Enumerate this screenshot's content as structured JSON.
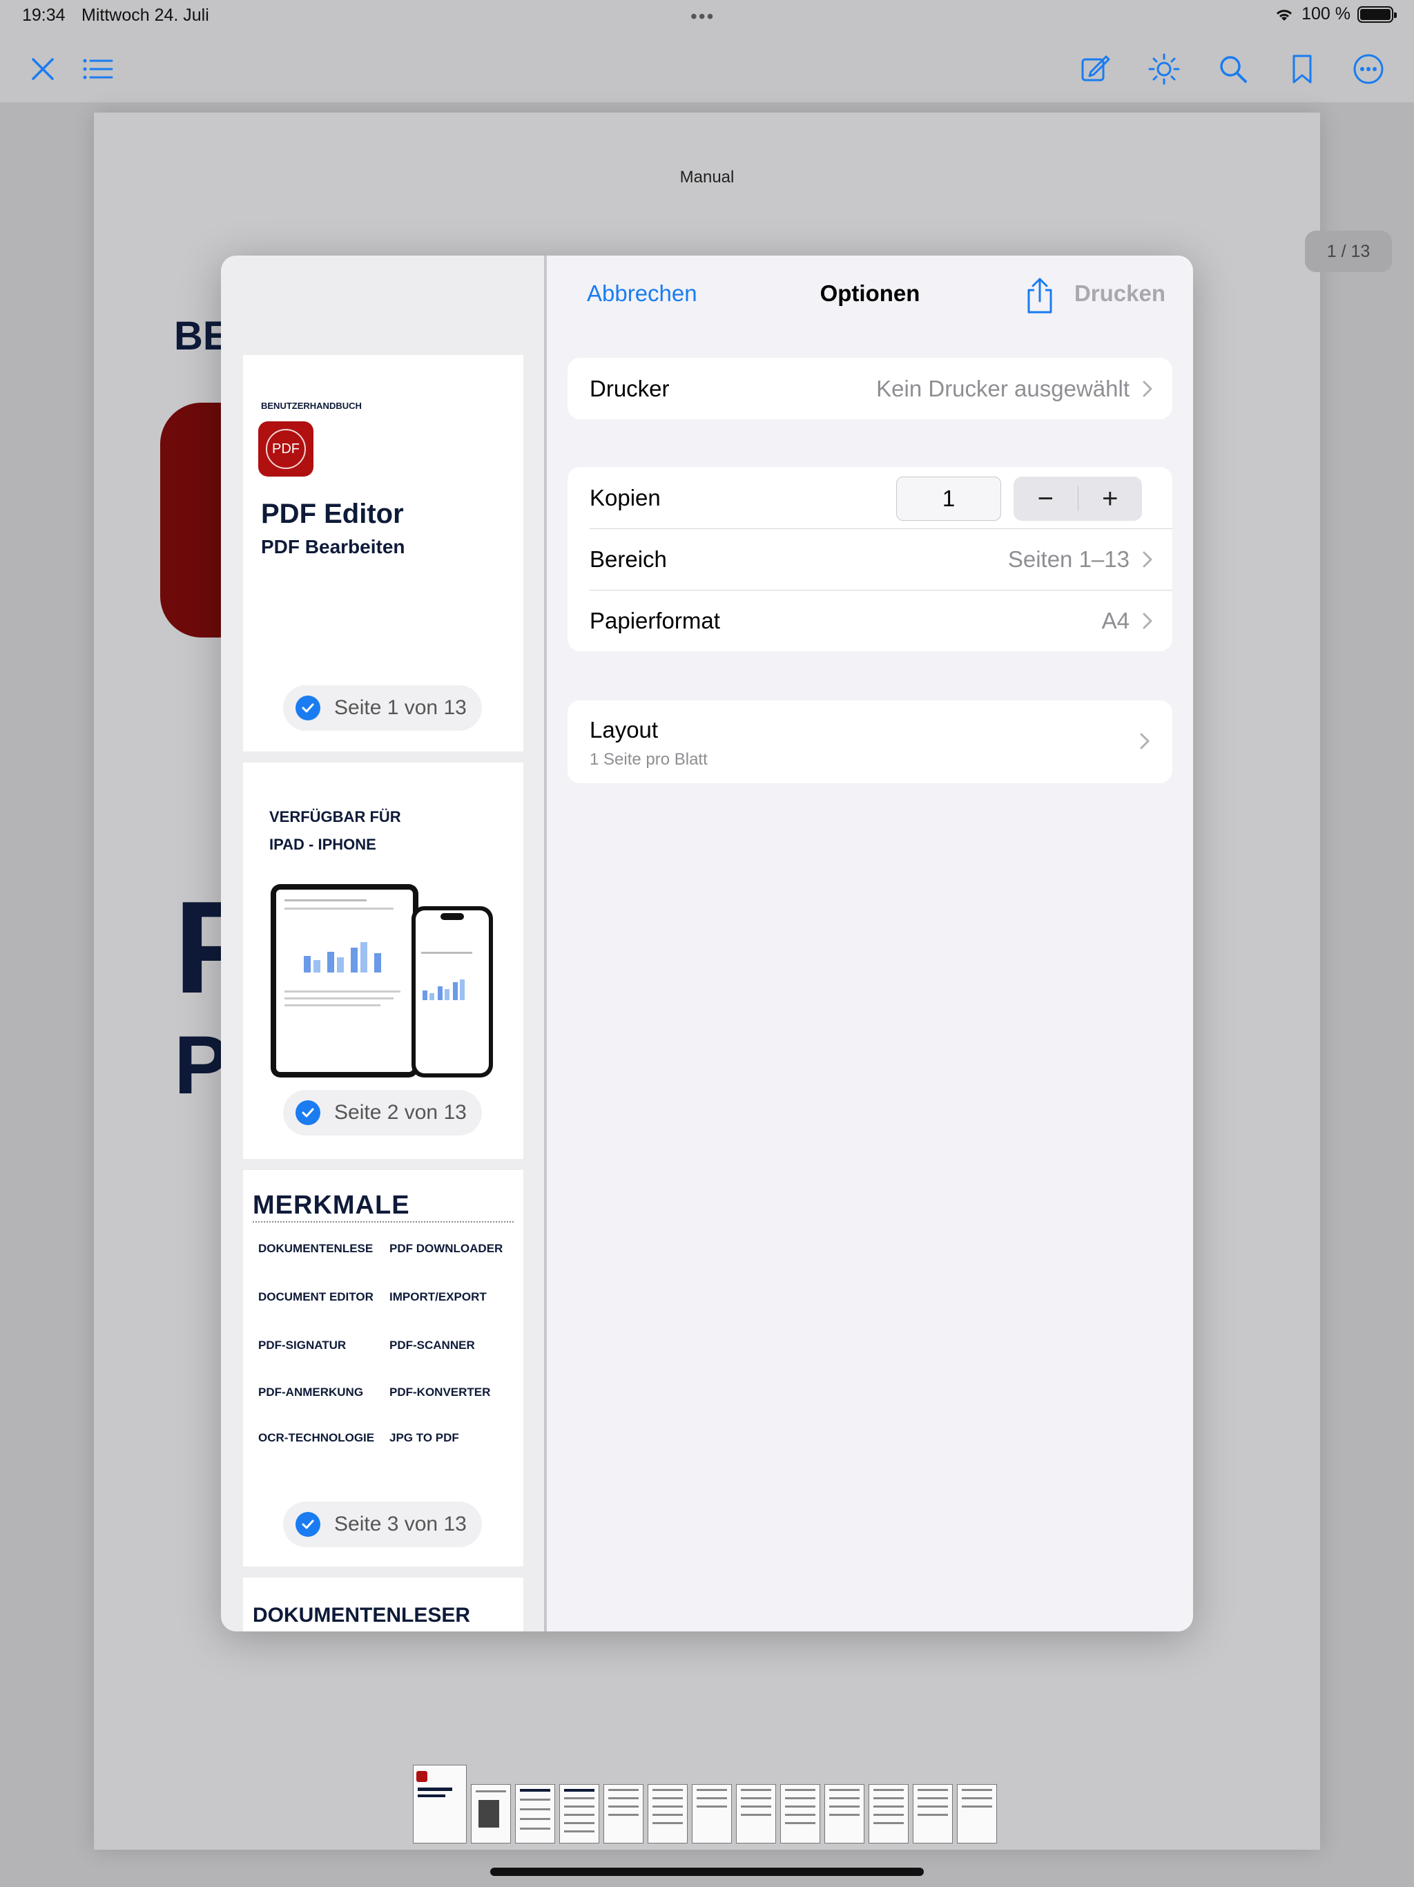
{
  "status": {
    "time": "19:34",
    "date": "Mittwoch 24. Juli",
    "battery": "100 %"
  },
  "toolbar": {
    "icons": [
      "close-icon",
      "list-icon",
      "edit-icon",
      "brightness-icon",
      "search-icon",
      "bookmark-icon",
      "more-icon"
    ]
  },
  "document": {
    "header": "Manual",
    "page_indicator": "1 / 13",
    "bg_title_fragment": "BE",
    "bg_big1": "P",
    "bg_big2": "P"
  },
  "dialog": {
    "cancel": "Abbrechen",
    "title": "Optionen",
    "print": "Drucken",
    "printer": {
      "label": "Drucker",
      "value": "Kein Drucker ausgewählt"
    },
    "copies": {
      "label": "Kopien",
      "value": "1",
      "minus": "−",
      "plus": "+"
    },
    "range": {
      "label": "Bereich",
      "value": "Seiten 1–13"
    },
    "paper": {
      "label": "Papierformat",
      "value": "A4"
    },
    "layout": {
      "label": "Layout",
      "sub": "1 Seite pro Blatt"
    }
  },
  "preview": {
    "page1": {
      "small": "BENUTZERHANDBUCH",
      "logo": "PDF",
      "title": "PDF Editor",
      "subtitle": "PDF Bearbeiten",
      "badge": "Seite 1 von 13"
    },
    "page2": {
      "line1": "VERFÜGBAR FÜR",
      "line2": "IPAD - IPHONE",
      "badge": "Seite 2 von 13"
    },
    "page3": {
      "title": "MERKMALE",
      "features": [
        "DOKUMENTENLESE",
        "PDF DOWNLOADER",
        "DOCUMENT EDITOR",
        "IMPORT/EXPORT",
        "PDF-SIGNATUR",
        "PDF-SCANNER",
        "PDF-ANMERKUNG",
        "PDF-KONVERTER",
        "OCR-TECHNOLOGIE",
        "JPG TO PDF"
      ],
      "badge": "Seite 3 von 13"
    },
    "page4": {
      "title": "DOKUMENTENLESER"
    }
  },
  "colors": {
    "accent": "#1a7cf0",
    "navy": "#0e1a38",
    "disabled": "#a9a9ad"
  }
}
